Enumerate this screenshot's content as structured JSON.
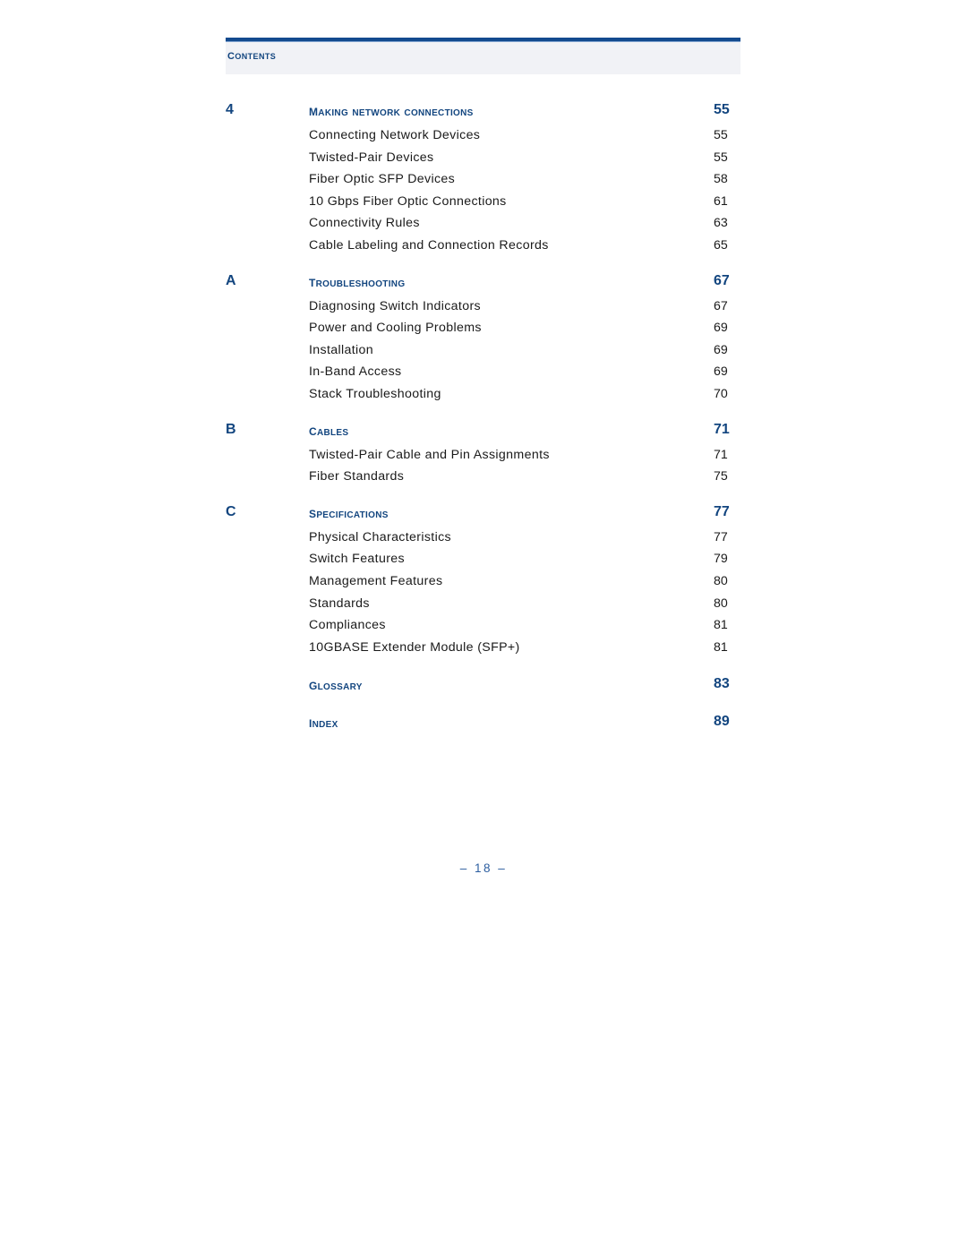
{
  "page": {
    "running_header": "Contents",
    "footer": "–  18  –",
    "accent_color": "#12457f",
    "body_text_color": "#1a1a1a",
    "header_band_color": "#f1f2f6",
    "header_rule_color": "#134a8e"
  },
  "toc": {
    "groups": [
      {
        "chapter_id": "4",
        "chapter_title": "Making Network Connections",
        "chapter_page": "55",
        "entries": [
          {
            "title": "Connecting Network Devices",
            "page": "55"
          },
          {
            "title": "Twisted-Pair Devices",
            "page": "55"
          },
          {
            "title": "Fiber Optic SFP Devices",
            "page": "58"
          },
          {
            "title": "10 Gbps Fiber Optic Connections",
            "page": "61"
          },
          {
            "title": "Connectivity Rules",
            "page": "63"
          },
          {
            "title": "Cable Labeling and Connection Records",
            "page": "65"
          }
        ]
      },
      {
        "chapter_id": "A",
        "chapter_title": "Troubleshooting",
        "chapter_page": "67",
        "entries": [
          {
            "title": "Diagnosing Switch Indicators",
            "page": "67"
          },
          {
            "title": "Power and Cooling Problems",
            "page": "69"
          },
          {
            "title": "Installation",
            "page": "69"
          },
          {
            "title": "In-Band Access",
            "page": "69"
          },
          {
            "title": "Stack Troubleshooting",
            "page": "70"
          }
        ]
      },
      {
        "chapter_id": "B",
        "chapter_title": "Cables",
        "chapter_page": "71",
        "entries": [
          {
            "title": "Twisted-Pair Cable and Pin Assignments",
            "page": "71"
          },
          {
            "title": "Fiber Standards",
            "page": "75"
          }
        ]
      },
      {
        "chapter_id": "C",
        "chapter_title": "Specifications",
        "chapter_page": "77",
        "entries": [
          {
            "title": "Physical Characteristics",
            "page": "77"
          },
          {
            "title": "Switch Features",
            "page": "79"
          },
          {
            "title": "Management Features",
            "page": "80"
          },
          {
            "title": "Standards",
            "page": "80"
          },
          {
            "title": "Compliances",
            "page": "81"
          },
          {
            "title": "10GBASE Extender Module (SFP+)",
            "page": "81"
          }
        ]
      }
    ],
    "standalone": [
      {
        "title": "Glossary",
        "page": "83"
      },
      {
        "title": "Index",
        "page": "89"
      }
    ]
  }
}
